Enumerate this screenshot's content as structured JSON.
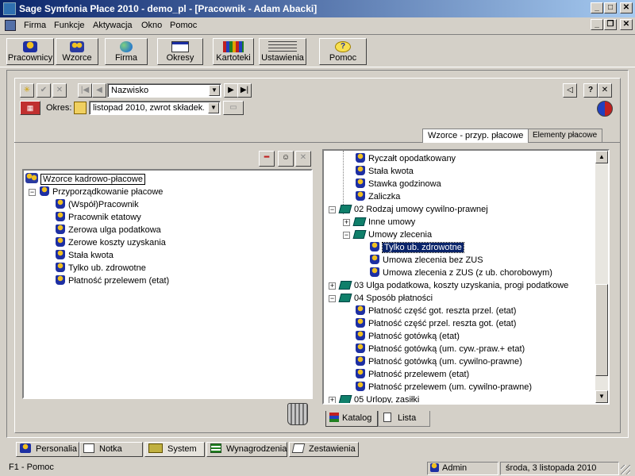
{
  "window": {
    "title": "Sage Symfonia Płace 2010 - demo_pl - [Pracownik - Adam Abacki]",
    "min": "_",
    "max": "□",
    "close": "✕"
  },
  "menu": [
    "Firma",
    "Funkcje",
    "Aktywacja",
    "Okno",
    "Pomoc"
  ],
  "toolbar": {
    "buttons": [
      "Pracownicy",
      "Wzorce",
      "Firma",
      "Okresy",
      "Kartoteki",
      "Ustawienia",
      "Pomoc"
    ]
  },
  "navigator": {
    "sort_field": "Nazwisko",
    "period_label": "Okres:",
    "period_value": "listopad 2010, zwrot składek...",
    "help": "?",
    "close": "✕"
  },
  "top_tabs": [
    "Wzorce - przyp. płacowe",
    "Elementy płacowe"
  ],
  "left_tree": {
    "root": "Wzorce kadrowo-płacowe",
    "group": "Przyporządkowanie płacowe",
    "items": [
      "(Współ)Pracownik",
      "Pracownik etatowy",
      "Zerowa ulga podatkowa",
      "Zerowe koszty uzyskania",
      "Stała kwota",
      "Tylko ub. zdrowotne",
      "Płatność przelewem (etat)"
    ]
  },
  "right_tree": {
    "items_a": [
      "Ryczałt opodatkowany",
      "Stała kwota",
      "Stawka godzinowa",
      "Zaliczka"
    ],
    "group_02": "02 Rodzaj umowy cywilno-prawnej",
    "sub_inne": "Inne umowy",
    "sub_zlecenia": "Umowy zlecenia",
    "zlecenia_items": [
      "Tylko ub. zdrowotne",
      "Umowa zlecenia bez ZUS",
      "Umowa zlecenia z ZUS (z ub. chorobowym)"
    ],
    "group_03": "03 Ulga podatkowa, koszty uzyskania, progi podatkowe",
    "group_04": "04 Sposób płatności",
    "platnosc_items": [
      "Płatność część got. reszta przel. (etat)",
      "Płatność część przel. reszta got. (etat)",
      "Płatność gotówką (etat)",
      "Płatność gotówką (um. cyw.-praw.+ etat)",
      "Płatność gotówką (um. cywilno-prawne)",
      "Płatność przelewem (etat)",
      "Płatność przelewem (um. cywilno-prawne)"
    ],
    "group_05": "05 Urlopy, zasiłki"
  },
  "bottom_tabs": [
    "Katalog",
    "Lista"
  ],
  "module_tabs": [
    "Personalia",
    "Notka",
    "System",
    "Wynagrodzenia",
    "Zestawienia"
  ],
  "status": {
    "help": "F1 - Pomoc",
    "user": "Admin",
    "date": "środa, 3 listopada 2010"
  },
  "colors": {
    "title_start": "#0a246a",
    "title_end": "#a6caf0",
    "selection": "#0a246a",
    "face": "#d4d0c8"
  }
}
